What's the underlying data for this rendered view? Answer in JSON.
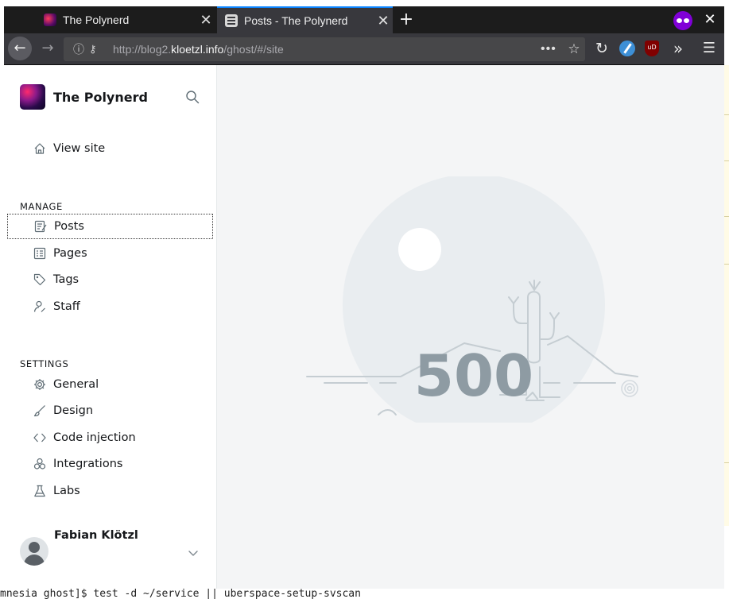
{
  "browser": {
    "tabs": [
      {
        "title": "The Polynerd",
        "active": false
      },
      {
        "title": "Posts - The Polynerd",
        "active": true
      }
    ],
    "url": {
      "prefix": "http://blog2.",
      "host": "kloetzl.info",
      "path": "/ghost/#/site"
    }
  },
  "sidebar": {
    "brand_title": "The Polynerd",
    "view_site_label": "View site",
    "manage_label": "MANAGE",
    "manage_items": [
      {
        "label": "Posts",
        "icon": "posts-icon"
      },
      {
        "label": "Pages",
        "icon": "pages-icon"
      },
      {
        "label": "Tags",
        "icon": "tag-icon"
      },
      {
        "label": "Staff",
        "icon": "staff-icon"
      }
    ],
    "settings_label": "SETTINGS",
    "settings_items": [
      {
        "label": "General",
        "icon": "gear-icon"
      },
      {
        "label": "Design",
        "icon": "brush-icon"
      },
      {
        "label": "Code injection",
        "icon": "code-icon"
      },
      {
        "label": "Integrations",
        "icon": "integrations-icon"
      },
      {
        "label": "Labs",
        "icon": "flask-icon"
      }
    ],
    "user_name": "Fabian Klötzl"
  },
  "main": {
    "error_code": "500"
  },
  "background_terminal": {
    "bottom_line": "mnesia ghost]$ test -d ~/service || uberspace-setup-svscan"
  },
  "colors": {
    "accent": "#0a84ff",
    "sidebar_bg": "#ffffff",
    "main_bg": "#f4f5f6",
    "error_text": "#8e9ba3"
  }
}
